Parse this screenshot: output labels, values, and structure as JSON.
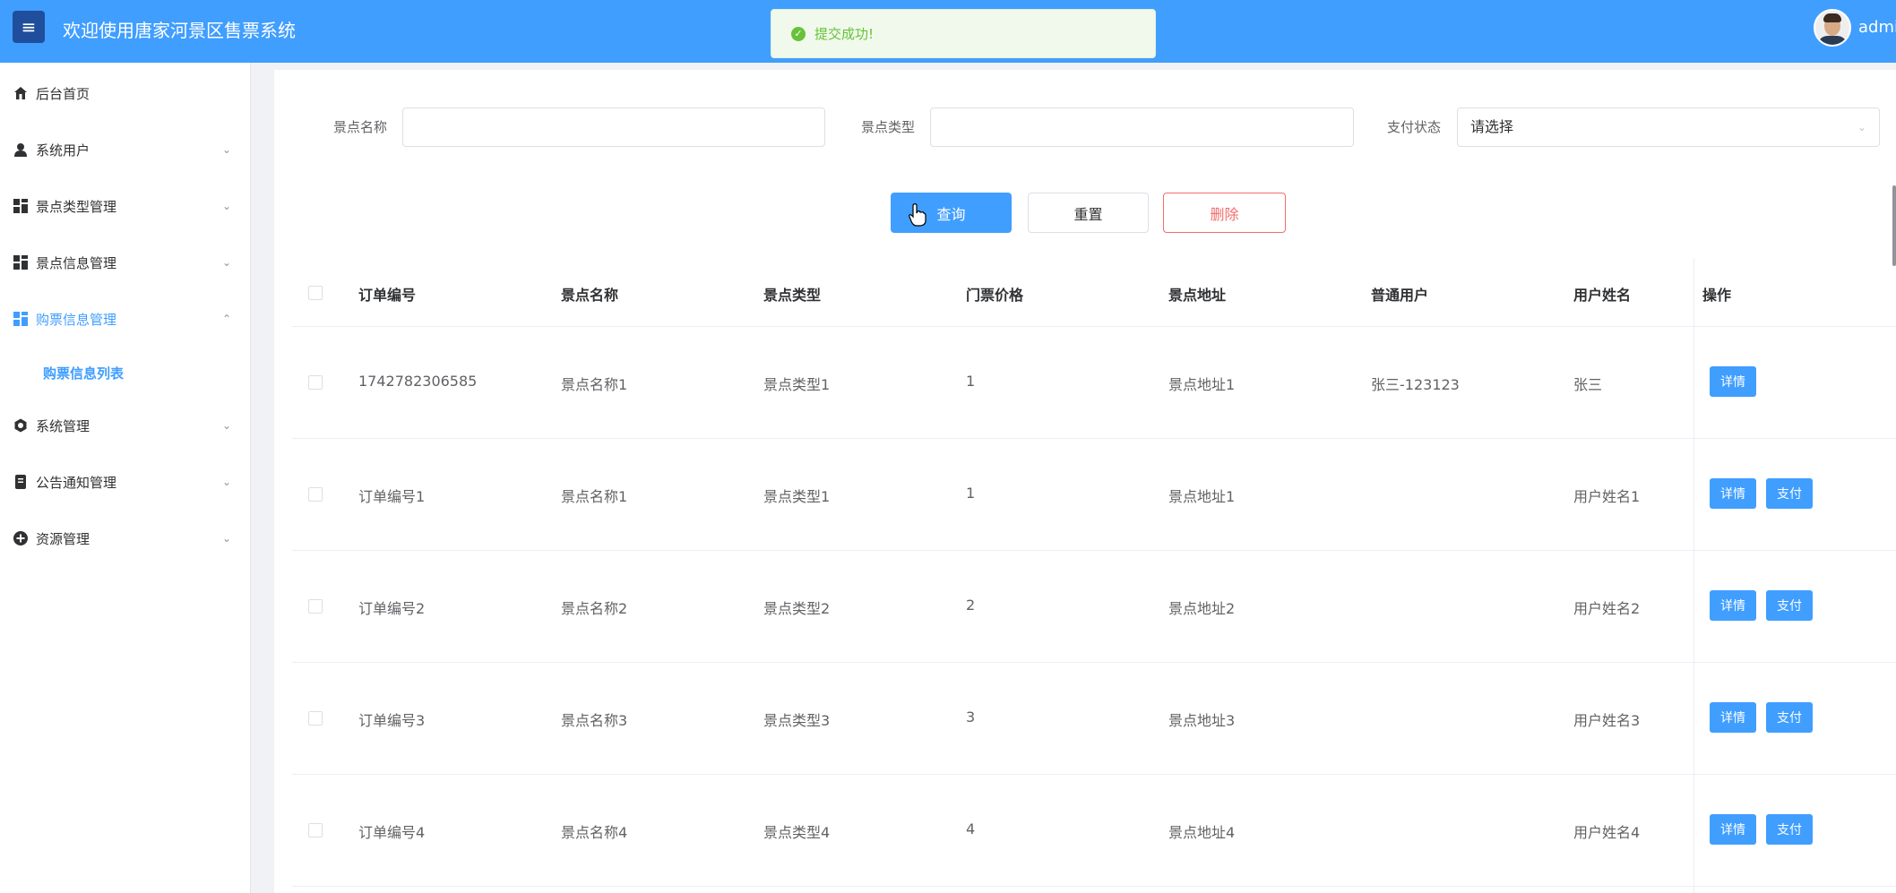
{
  "header": {
    "menu_icon": "≡",
    "title": "欢迎使用唐家河景区售票系统",
    "toast": "提交成功!",
    "toast_icon": "✓",
    "username": "admin",
    "accent": "#409eff"
  },
  "sidebar": {
    "items": [
      {
        "label": "后台首页",
        "icon": "home-icon"
      },
      {
        "label": "系统用户",
        "icon": "user-icon"
      },
      {
        "label": "景点类型管理",
        "icon": "grid-icon"
      },
      {
        "label": "景点信息管理",
        "icon": "grid-icon"
      },
      {
        "label": "购票信息管理",
        "icon": "grid-icon"
      },
      {
        "label": "系统管理",
        "icon": "gear-icon"
      },
      {
        "label": "公告通知管理",
        "icon": "document-icon"
      },
      {
        "label": "资源管理",
        "icon": "plus-circle-icon"
      }
    ],
    "sub_item": "购票信息列表"
  },
  "filters": {
    "spot_name_label": "景点名称",
    "spot_name_value": "",
    "spot_type_label": "景点类型",
    "spot_type_value": "",
    "pay_status_label": "支付状态",
    "pay_status_value": "请选择"
  },
  "buttons": {
    "query": "查询",
    "reset": "重置",
    "delete": "删除"
  },
  "table": {
    "columns": [
      "订单编号",
      "景点名称",
      "景点类型",
      "门票价格",
      "景点地址",
      "普通用户",
      "用户姓名",
      "操作"
    ],
    "rows": [
      {
        "order_no": "1742782306585",
        "spot_name": "景点名称1",
        "spot_type": "景点类型1",
        "price": "1",
        "address": "景点地址1",
        "user": "张三-123123",
        "user_name": "张三",
        "detail": "详情",
        "pay": ""
      },
      {
        "order_no": "订单编号1",
        "spot_name": "景点名称1",
        "spot_type": "景点类型1",
        "price": "1",
        "address": "景点地址1",
        "user": "",
        "user_name": "用户姓名1",
        "detail": "详情",
        "pay": "支付"
      },
      {
        "order_no": "订单编号2",
        "spot_name": "景点名称2",
        "spot_type": "景点类型2",
        "price": "2",
        "address": "景点地址2",
        "user": "",
        "user_name": "用户姓名2",
        "detail": "详情",
        "pay": "支付"
      },
      {
        "order_no": "订单编号3",
        "spot_name": "景点名称3",
        "spot_type": "景点类型3",
        "price": "3",
        "address": "景点地址3",
        "user": "",
        "user_name": "用户姓名3",
        "detail": "详情",
        "pay": "支付"
      },
      {
        "order_no": "订单编号4",
        "spot_name": "景点名称4",
        "spot_type": "景点类型4",
        "price": "4",
        "address": "景点地址4",
        "user": "",
        "user_name": "用户姓名4",
        "detail": "详情",
        "pay": "支付"
      }
    ]
  }
}
